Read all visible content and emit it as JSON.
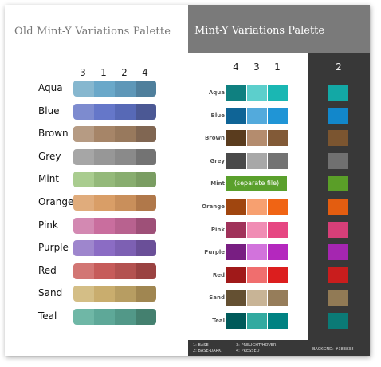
{
  "left": {
    "title": "Old Mint-Y Variations Palette",
    "columns": [
      "3",
      "1",
      "2",
      "4"
    ],
    "rows": [
      {
        "name": "Aqua",
        "colors": [
          "#86b7cf",
          "#6aa8c9",
          "#5e97b8",
          "#4f7f9c"
        ]
      },
      {
        "name": "Blue",
        "colors": [
          "#7d8bcf",
          "#6577c9",
          "#5769b6",
          "#4b5894"
        ]
      },
      {
        "name": "Brown",
        "colors": [
          "#b69b83",
          "#a68568",
          "#98795d",
          "#806652"
        ]
      },
      {
        "name": "Grey",
        "colors": [
          "#a6a6a6",
          "#979797",
          "#8a8a8a",
          "#737373"
        ]
      },
      {
        "name": "Mint",
        "colors": [
          "#a9cc8f",
          "#94b97a",
          "#88ad6f",
          "#7a9d62"
        ]
      },
      {
        "name": "Orange",
        "colors": [
          "#e0ac7c",
          "#d99e67",
          "#c98f5b",
          "#b0784a"
        ]
      },
      {
        "name": "Pink",
        "colors": [
          "#d389b2",
          "#c96e9e",
          "#b8628f",
          "#9e5078"
        ]
      },
      {
        "name": "Purple",
        "colors": [
          "#9e86cd",
          "#8b6cc4",
          "#7d60b3",
          "#6a4f98"
        ]
      },
      {
        "name": "Red",
        "colors": [
          "#d27674",
          "#c65c5a",
          "#b35250",
          "#9a4241"
        ]
      },
      {
        "name": "Sand",
        "colors": [
          "#d4be86",
          "#c9ad6e",
          "#b79d62",
          "#a08651"
        ]
      },
      {
        "name": "Teal",
        "colors": [
          "#6fb7a6",
          "#5ea898",
          "#529888",
          "#44806f"
        ]
      }
    ]
  },
  "right": {
    "title": "Mint-Y Variations Palette",
    "columns": [
      "4",
      "3",
      "1"
    ],
    "dark_column": "2",
    "separate_text": "(separate file)",
    "rows": [
      {
        "name": "Aqua",
        "colors": [
          "#0f8080",
          "#5ccfcc",
          "#1ab7b3"
        ],
        "dark": "#13a8a5"
      },
      {
        "name": "Blue",
        "colors": [
          "#0f6496",
          "#53aadc",
          "#2095d6"
        ],
        "dark": "#1287cb"
      },
      {
        "name": "Brown",
        "colors": [
          "#5a3c1e",
          "#b48c6e",
          "#825a37"
        ],
        "dark": "#7b5530"
      },
      {
        "name": "Grey",
        "colors": [
          "#4a4a4a",
          "#a8a8a8",
          "#737373"
        ],
        "dark": "#707070"
      },
      {
        "name": "Mint",
        "colors": null,
        "dark": "#5a9e28"
      },
      {
        "name": "Orange",
        "colors": [
          "#a0460f",
          "#f7a070",
          "#f06414"
        ],
        "dark": "#e35d10"
      },
      {
        "name": "Pink",
        "colors": [
          "#a0325a",
          "#f08cb4",
          "#e64682"
        ],
        "dark": "#d63f78"
      },
      {
        "name": "Purple",
        "colors": [
          "#781e82",
          "#d273dc",
          "#b428be"
        ],
        "dark": "#a526b0"
      },
      {
        "name": "Red",
        "colors": [
          "#a01919",
          "#f06e6e",
          "#dc1e1e"
        ],
        "dark": "#c91d1d"
      },
      {
        "name": "Sand",
        "colors": [
          "#645032",
          "#c8b496",
          "#967d5a"
        ],
        "dark": "#917a55"
      },
      {
        "name": "Teal",
        "colors": [
          "#005a5a",
          "#32aaa0",
          "#008282"
        ],
        "dark": "#0b7a76"
      }
    ],
    "legend": {
      "line1_left": "1: BASE",
      "line2_left": "2: BASE-DARK",
      "line1_right": "3: PRELIGHT/HOVER",
      "line2_right": "4: PRESSED",
      "backgnd": "BACKGND: #383838"
    }
  }
}
